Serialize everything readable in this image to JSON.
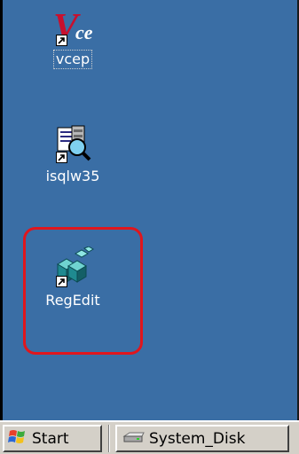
{
  "desktop": {
    "background_color": "#3a6ea5",
    "icons": [
      {
        "label": "vcep",
        "icon": "vce-script-icon",
        "shortcut": true,
        "focused": true
      },
      {
        "label": "isqlw35",
        "icon": "sql-query-icon",
        "shortcut": true
      },
      {
        "label": "RegEdit",
        "icon": "registry-editor-icon",
        "shortcut": true,
        "highlighted": true
      }
    ],
    "highlight_color": "#e0161d"
  },
  "taskbar": {
    "start_label": "Start",
    "start_icon": "windows-flag-icon",
    "task_label": "System_Disk",
    "task_icon": "disk-drive-icon"
  }
}
